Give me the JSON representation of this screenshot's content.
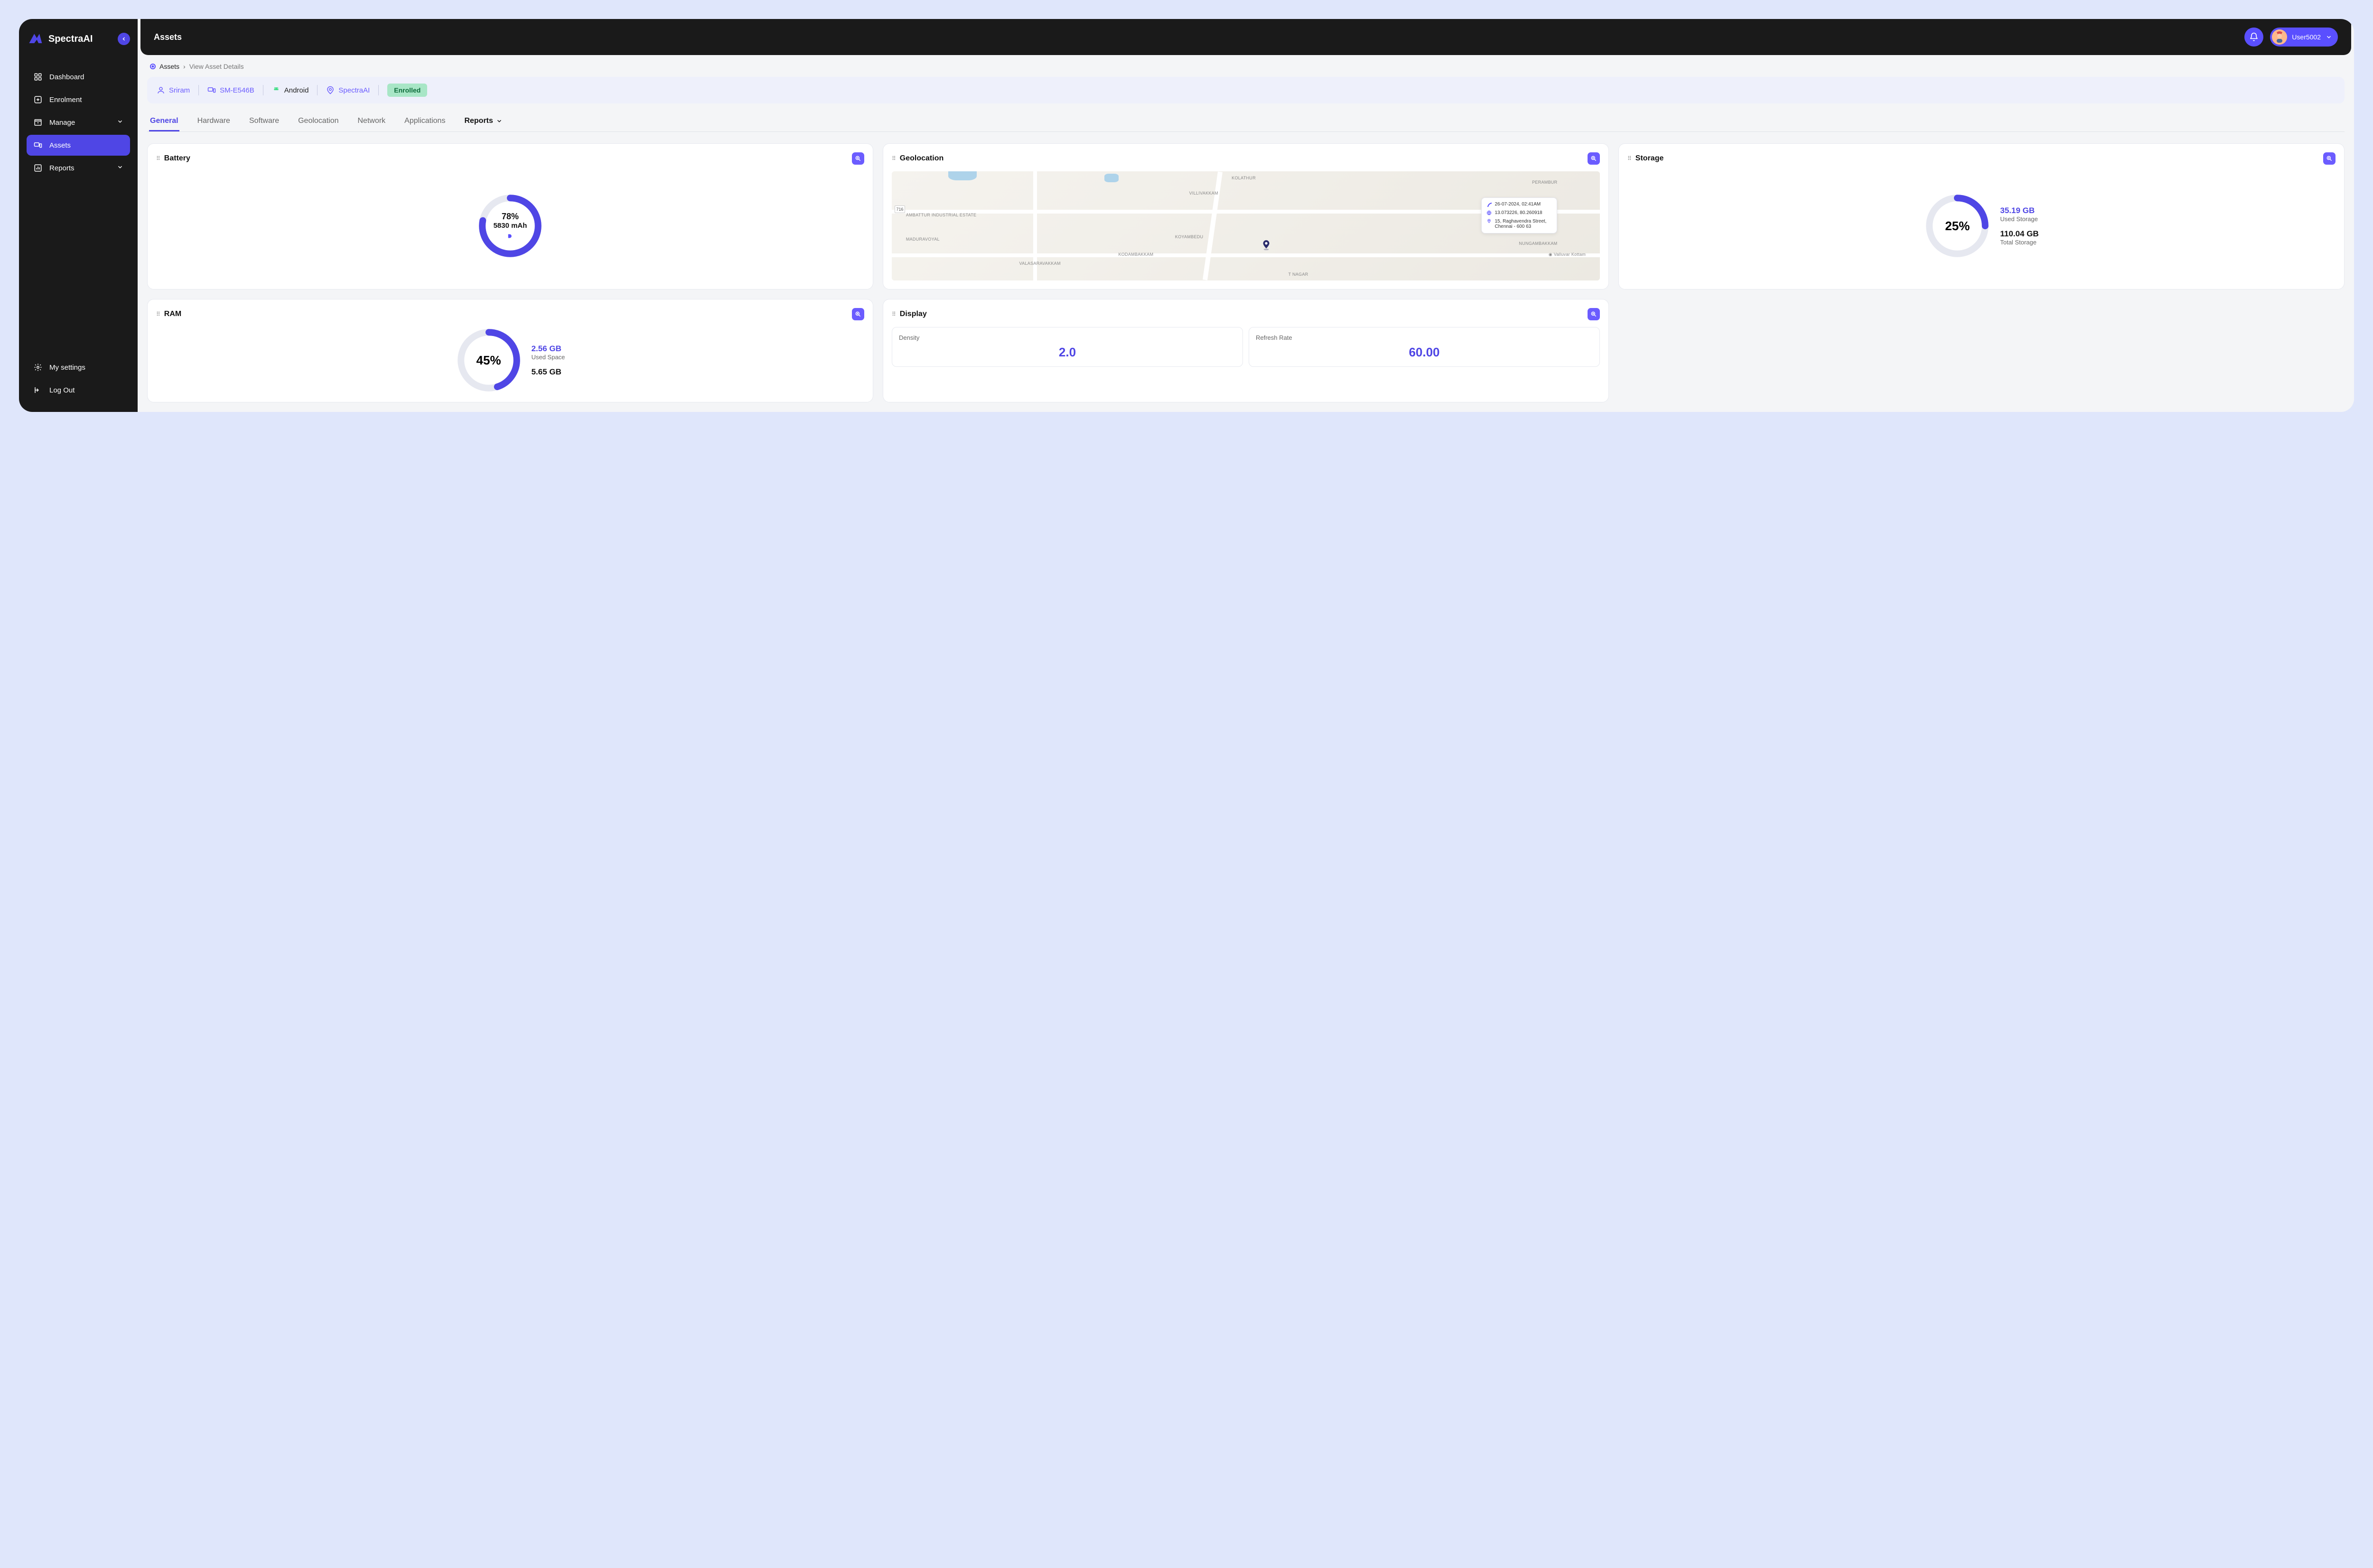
{
  "brand": {
    "name": "SpectraAI"
  },
  "header": {
    "title": "Assets",
    "user": "User5002"
  },
  "sidebar": {
    "items": [
      {
        "label": "Dashboard"
      },
      {
        "label": "Enrolment"
      },
      {
        "label": "Manage"
      },
      {
        "label": "Assets"
      },
      {
        "label": "Reports"
      }
    ],
    "bottom": [
      {
        "label": "My settings"
      },
      {
        "label": "Log Out"
      }
    ]
  },
  "breadcrumb": {
    "root": "Assets",
    "current": "View Asset Details"
  },
  "infobar": {
    "owner": "Sriram",
    "device": "SM-E546B",
    "os": "Android",
    "org": "SpectraAI",
    "status": "Enrolled"
  },
  "tabs": [
    "General",
    "Hardware",
    "Software",
    "Geolocation",
    "Network",
    "Applications",
    "Reports"
  ],
  "cards": {
    "battery": {
      "title": "Battery",
      "percent": "78%",
      "capacity": "5830 mAh",
      "pct_num": 78
    },
    "geolocation": {
      "title": "Geolocation",
      "timestamp": "26-07-2024, 02:41AM",
      "coords": "13.073226, 80.260918",
      "address": "15, Raghavendra Street, Chennai - 600 63",
      "map_labels": {
        "kolathur": "KOLATHUR",
        "perambur": "PERAMBUR",
        "villivakkam": "VILLIVAKKAM",
        "ambattur": "AMBATTUR INDUSTRIAL ESTATE",
        "koyambedu": "KOYAMBEDU",
        "nungambakkam": "NUNGAMBAKKAM",
        "maduravoyal": "MADURAVOYAL",
        "kodambakkam": "KODAMBAKKAM",
        "valasaravakkam": "VALASARAVAKKAM",
        "tnagar": "T NAGAR",
        "valluvar": "Valluvar Kottam",
        "hwy": "716"
      }
    },
    "storage": {
      "title": "Storage",
      "percent": "25%",
      "pct_num": 25,
      "used": "35.19 GB",
      "used_label": "Used Storage",
      "total": "110.04 GB",
      "total_label": "Total Storage"
    },
    "ram": {
      "title": "RAM",
      "percent": "45%",
      "pct_num": 45,
      "used": "2.56 GB",
      "used_label": "Used Space",
      "total": "5.65 GB"
    },
    "display": {
      "title": "Display",
      "density_label": "Density",
      "density": "2.0",
      "refresh_label": "Refresh Rate",
      "refresh": "60.00"
    }
  }
}
